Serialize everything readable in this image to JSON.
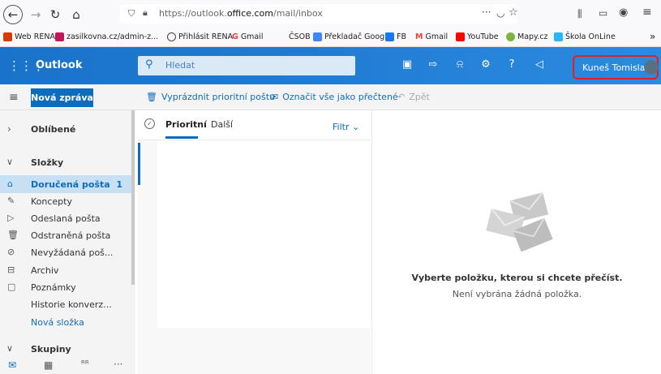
{
  "browser": {
    "url_prefix": "https://outlook.",
    "url_domain": "office.com",
    "url_path": "/mail/inbox",
    "overflow_menu": "···",
    "bookmarks": [
      {
        "label": "Web RENA",
        "color": "#d83b01"
      },
      {
        "label": "zasilkovna.cz/admin-z...",
        "color": "#c2185b"
      },
      {
        "label": "Přihlásit RENA",
        "color": "#444444"
      },
      {
        "label": "Gmail",
        "color": "#ea4335"
      },
      {
        "label": "ČSOB",
        "color": ""
      },
      {
        "label": "Překladač Google",
        "color": "#4285f4"
      },
      {
        "label": "FB",
        "color": "#1877f2"
      },
      {
        "label": "Gmail",
        "color": "#ea4335"
      },
      {
        "label": "YouTube",
        "color": "#ff0000"
      },
      {
        "label": "Mapy.cz",
        "color": "#7cb342"
      },
      {
        "label": "Škola OnLine",
        "color": "#29b6f6"
      }
    ],
    "bookmarks_more": "»"
  },
  "topbar": {
    "brand": "Outlook",
    "search_placeholder": "Hledat",
    "user_name": "Kuneš Tomislav"
  },
  "commandbar": {
    "new_mail": "Nová zpráva",
    "empty_focused": "Vyprázdnit prioritní poštu",
    "mark_all_read": "Označit vše jako přečtené",
    "undo": "Zpět"
  },
  "leftnav": {
    "favorites": "Oblíbené",
    "folders_header": "Složky",
    "folders": [
      {
        "label": "Doručená pošta",
        "count": "1",
        "icon": "inbox-icon",
        "selected": true
      },
      {
        "label": "Koncepty",
        "count": "",
        "icon": "pencil-icon"
      },
      {
        "label": "Odeslaná pošta",
        "count": "",
        "icon": "send-icon"
      },
      {
        "label": "Odstraněná pošta",
        "count": "",
        "icon": "trash-icon"
      },
      {
        "label": "Nevyžádaná poš...",
        "count": "",
        "icon": "block-icon"
      },
      {
        "label": "Archiv",
        "count": "",
        "icon": "archive-icon"
      },
      {
        "label": "Poznámky",
        "count": "",
        "icon": "note-icon"
      },
      {
        "label": "Historie konverz...",
        "count": "",
        "icon": ""
      }
    ],
    "new_folder": "Nová složka",
    "groups_header": "Skupiny"
  },
  "list": {
    "tab_focused": "Prioritní",
    "tab_other": "Další",
    "filter": "Filtr"
  },
  "reading": {
    "title": "Vyberte položku, kterou si chcete přečíst.",
    "subtitle": "Není vybrána žádná položka."
  },
  "colors": {
    "accent": "#0f6cbd",
    "selected_bg": "#c7e0f4",
    "highlight_box": "#e32020"
  }
}
